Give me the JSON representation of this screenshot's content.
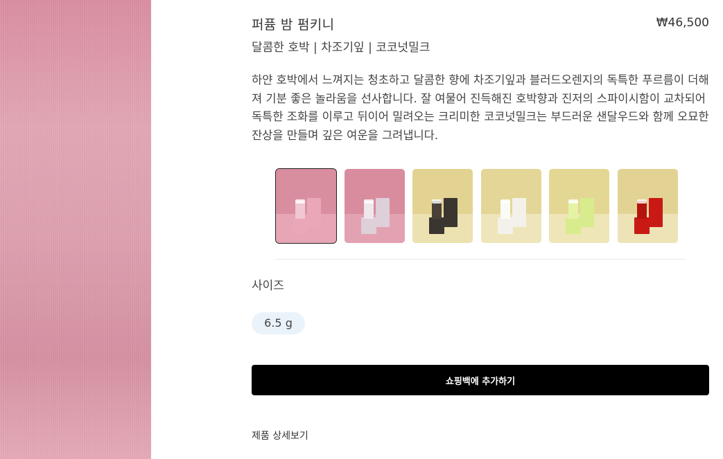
{
  "product": {
    "name": "퍼퓸 밤 펌키니",
    "price": "₩46,500",
    "notes": "달콤한 호박 | 차조기잎 | 코코넛밀크",
    "description": "하얀 호박에서 느껴지는 청초하고 달콤한 향에 차조기잎과 블러드오렌지의 독특한 푸르름이 더해져 기분 좋은 놀라움을 선사합니다. 잘 여물어 진득해진 호박향과 진저의 스파이시함이 교차되어 독특한 조화를 이루고 뒤이어 밀려오는 크리미한 코코넛밀크는 부드러운 샌달우드와 함께 오묘한 잔상을 만들며 깊은 여운을 그려냅니다."
  },
  "thumbnails": [
    {
      "selected": true,
      "bg": "#d98ea0",
      "floor": "#e7a6b5",
      "box": "#e9a7b8",
      "tube": "#f0c7d2"
    },
    {
      "selected": false,
      "bg": "#d88c9e",
      "floor": "#e3a2b1",
      "box": "#ddd0d8",
      "tube": "#eee7ec"
    },
    {
      "selected": false,
      "bg": "#e2d392",
      "floor": "#ece1b0",
      "box": "#3b3530",
      "tube": "#4a4038"
    },
    {
      "selected": false,
      "bg": "#e3d696",
      "floor": "#eee5bb",
      "box": "#f3f1ea",
      "tube": "#fafaf6"
    },
    {
      "selected": false,
      "bg": "#e4d794",
      "floor": "#eee6b7",
      "box": "#d8eb8d",
      "tube": "#e4f3a4"
    },
    {
      "selected": false,
      "bg": "#e2d394",
      "floor": "#ede3b7",
      "box": "#c81914",
      "tube": "#b3140f"
    }
  ],
  "size": {
    "label": "사이즈",
    "selected": "6.5 g"
  },
  "actions": {
    "add_to_bag": "쇼핑백에 추가하기",
    "view_details": "제품 상세보기"
  }
}
